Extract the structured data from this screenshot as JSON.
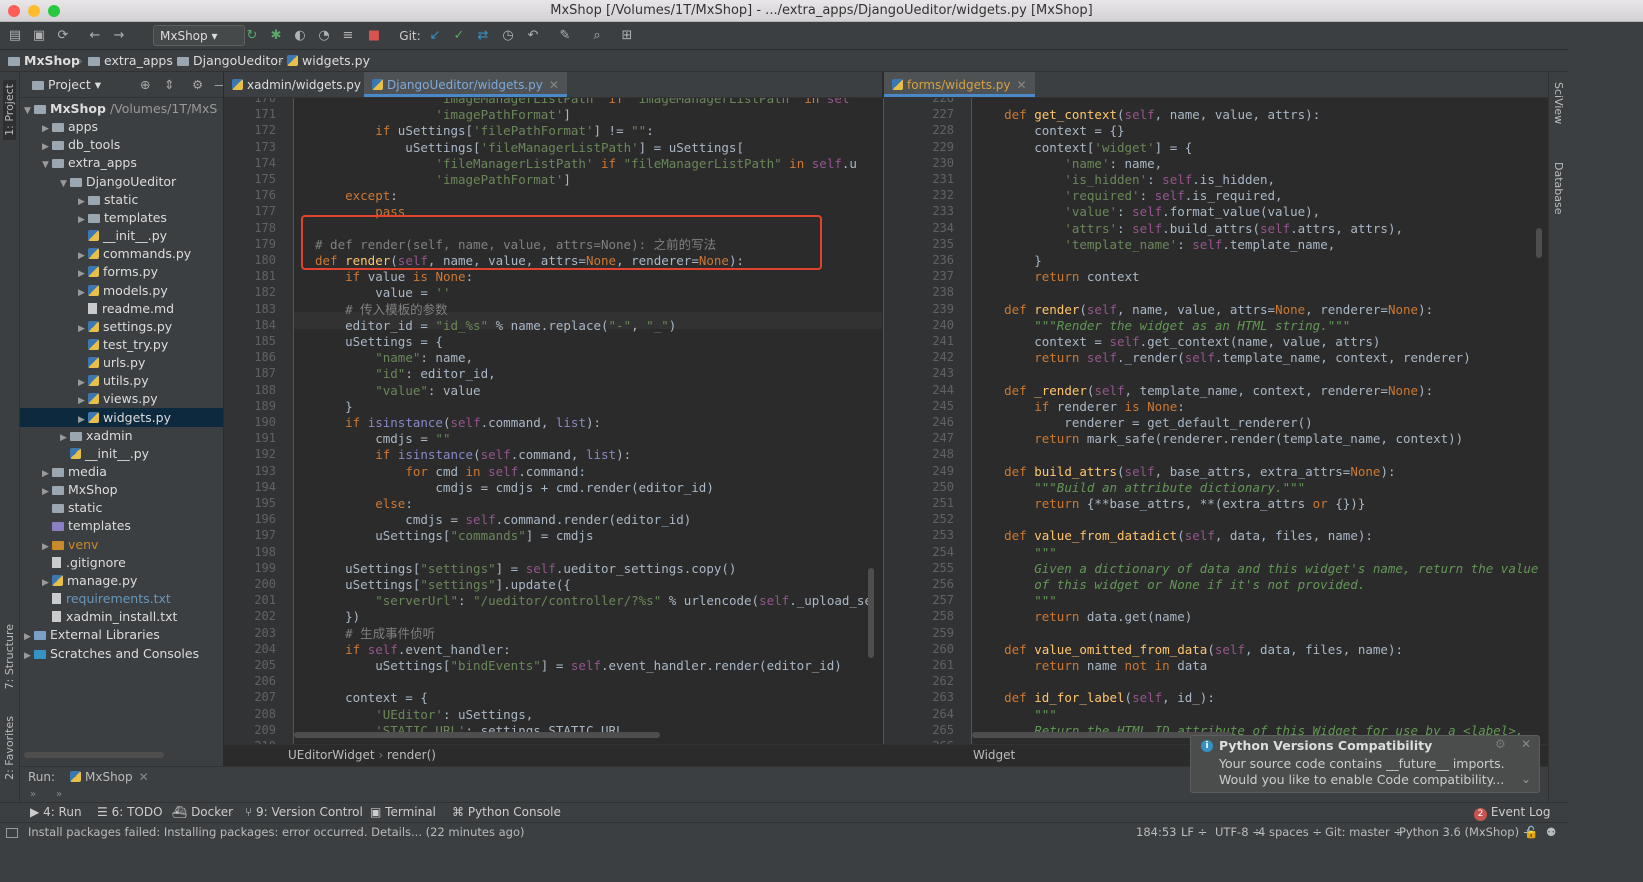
{
  "window": {
    "title": "MxShop [/Volumes/1T/MxShop] - .../extra_apps/DjangoUeditor/widgets.py [MxShop]"
  },
  "toolbar": {
    "run_config": "MxShop",
    "git_label": "Git:"
  },
  "breadcrumb": [
    "MxShop",
    "extra_apps",
    "DjangoUeditor",
    "widgets.py"
  ],
  "left_stripe": {
    "project": "1: Project",
    "structure": "7: Structure",
    "favorites": "2: Favorites"
  },
  "right_stripe": {
    "sciview": "SciView",
    "database": "Database"
  },
  "project": {
    "header": "Project",
    "root_name": "MxShop",
    "root_path": "/Volumes/1T/MxS",
    "items": [
      {
        "label": "apps",
        "depth": 1,
        "kind": "folder",
        "arrow": "right"
      },
      {
        "label": "db_tools",
        "depth": 1,
        "kind": "folder",
        "arrow": "right"
      },
      {
        "label": "extra_apps",
        "depth": 1,
        "kind": "folder",
        "arrow": "down"
      },
      {
        "label": "DjangoUeditor",
        "depth": 2,
        "kind": "folder",
        "arrow": "down"
      },
      {
        "label": "static",
        "depth": 3,
        "kind": "folder",
        "arrow": "right"
      },
      {
        "label": "templates",
        "depth": 3,
        "kind": "folder",
        "arrow": "right"
      },
      {
        "label": "__init__.py",
        "depth": 3,
        "kind": "py",
        "arrow": ""
      },
      {
        "label": "commands.py",
        "depth": 3,
        "kind": "py",
        "arrow": "right"
      },
      {
        "label": "forms.py",
        "depth": 3,
        "kind": "py",
        "arrow": "right"
      },
      {
        "label": "models.py",
        "depth": 3,
        "kind": "py",
        "arrow": "right"
      },
      {
        "label": "readme.md",
        "depth": 3,
        "kind": "txt",
        "arrow": ""
      },
      {
        "label": "settings.py",
        "depth": 3,
        "kind": "py",
        "arrow": "right"
      },
      {
        "label": "test_try.py",
        "depth": 3,
        "kind": "py",
        "arrow": ""
      },
      {
        "label": "urls.py",
        "depth": 3,
        "kind": "py",
        "arrow": ""
      },
      {
        "label": "utils.py",
        "depth": 3,
        "kind": "py",
        "arrow": "right"
      },
      {
        "label": "views.py",
        "depth": 3,
        "kind": "py",
        "arrow": "right"
      },
      {
        "label": "widgets.py",
        "depth": 3,
        "kind": "py",
        "arrow": "right",
        "selected": true
      },
      {
        "label": "xadmin",
        "depth": 2,
        "kind": "folder",
        "arrow": "right"
      },
      {
        "label": "__init__.py",
        "depth": 2,
        "kind": "py",
        "arrow": ""
      },
      {
        "label": "media",
        "depth": 1,
        "kind": "folder",
        "arrow": "right"
      },
      {
        "label": "MxShop",
        "depth": 1,
        "kind": "folder",
        "arrow": "right"
      },
      {
        "label": "static",
        "depth": 1,
        "kind": "folder",
        "arrow": ""
      },
      {
        "label": "templates",
        "depth": 1,
        "kind": "folderp",
        "arrow": ""
      },
      {
        "label": "venv",
        "depth": 1,
        "kind": "venv",
        "arrow": "right",
        "venv": true
      },
      {
        "label": ".gitignore",
        "depth": 1,
        "kind": "git",
        "arrow": ""
      },
      {
        "label": "manage.py",
        "depth": 1,
        "kind": "py",
        "arrow": "right"
      },
      {
        "label": "requirements.txt",
        "depth": 1,
        "kind": "txt",
        "arrow": "",
        "blue": true
      },
      {
        "label": "xadmin_install.txt",
        "depth": 1,
        "kind": "txt",
        "arrow": ""
      },
      {
        "label": "External Libraries",
        "depth": 0,
        "kind": "lib",
        "arrow": "right"
      },
      {
        "label": "Scratches and Consoles",
        "depth": 0,
        "kind": "scratch",
        "arrow": "right"
      }
    ]
  },
  "left_editor": {
    "tabs": [
      {
        "label": "xadmin/widgets.py",
        "active": false
      },
      {
        "label": "DjangoUeditor/widgets.py",
        "active": true
      }
    ],
    "breadcrumb": [
      "UEditorWidget",
      "render()"
    ],
    "lines": [
      {
        "n": "170",
        "html": "                <span class=\"str\">'imageManagerListPath'</span> <span class=\"kw\">if</span> <span class=\"str\">\"imageManagerListPath\"</span> <span class=\"kw\">in</span> <span class=\"sf\">sel</span>"
      },
      {
        "n": "171",
        "html": "                <span class=\"str\">'imagePathFormat'</span>]"
      },
      {
        "n": "172",
        "html": "        <span class=\"kw\">if</span> uSettings[<span class=\"str\">'filePathFormat'</span>] != <span class=\"str\">\"\"</span>:"
      },
      {
        "n": "173",
        "html": "            uSettings[<span class=\"str\">'fileManagerListPath'</span>] = uSettings["
      },
      {
        "n": "174",
        "html": "                <span class=\"str\">'fileManagerListPath'</span> <span class=\"kw\">if</span> <span class=\"str\">\"fileManagerListPath\"</span> <span class=\"kw\">in</span> <span class=\"sf\">self</span>.u"
      },
      {
        "n": "175",
        "html": "                <span class=\"str\">'imagePathFormat'</span>]"
      },
      {
        "n": "176",
        "html": "    <span class=\"kw\">except</span>:"
      },
      {
        "n": "177",
        "html": "        <span class=\"kw\">pass</span>"
      },
      {
        "n": "178",
        "html": ""
      },
      {
        "n": "179",
        "html": "<span class=\"cm\"># def render(self, name, value, attrs=None): 之前的写法</span>"
      },
      {
        "n": "180",
        "html": "<span class=\"kw\">def</span> <span class=\"fn\">render</span>(<span class=\"sf\">self</span>, name, value, attrs=<span class=\"kw\">None</span>, renderer=<span class=\"kw\">None</span>):"
      },
      {
        "n": "181",
        "html": "    <span class=\"kw\">if</span> value <span class=\"kw\">is</span> <span class=\"kw\">None</span>:"
      },
      {
        "n": "182",
        "html": "        value = <span class=\"str\">''</span>"
      },
      {
        "n": "183",
        "html": "    <span class=\"cm\"># 传入模板的参数</span>"
      },
      {
        "n": "184",
        "html": "    editor_id = <span class=\"str\">\"id_%s\"</span> % name.replace(<span class=\"str\">\"-\"</span>, <span class=\"str\">\"_\"</span>)"
      },
      {
        "n": "185",
        "html": "    uSettings = {"
      },
      {
        "n": "186",
        "html": "        <span class=\"str\">\"name\"</span>: name,"
      },
      {
        "n": "187",
        "html": "        <span class=\"str\">\"id\"</span>: editor_id,"
      },
      {
        "n": "188",
        "html": "        <span class=\"str\">\"value\"</span>: value"
      },
      {
        "n": "189",
        "html": "    }"
      },
      {
        "n": "190",
        "html": "    <span class=\"kw\">if</span> <span class=\"bi\">isinstance</span>(<span class=\"sf\">self</span>.command, <span class=\"bi\">list</span>):"
      },
      {
        "n": "191",
        "html": "        cmdjs = <span class=\"str\">\"\"</span>"
      },
      {
        "n": "192",
        "html": "        <span class=\"kw\">if</span> <span class=\"bi\">isinstance</span>(<span class=\"sf\">self</span>.command, <span class=\"bi\">list</span>):"
      },
      {
        "n": "193",
        "html": "            <span class=\"kw\">for</span> cmd <span class=\"kw\">in</span> <span class=\"sf\">self</span>.command:"
      },
      {
        "n": "194",
        "html": "                cmdjs = cmdjs + cmd.render(editor_id)"
      },
      {
        "n": "195",
        "html": "        <span class=\"kw\">else</span>:"
      },
      {
        "n": "196",
        "html": "            cmdjs = <span class=\"sf\">self</span>.command.render(editor_id)"
      },
      {
        "n": "197",
        "html": "        uSettings[<span class=\"str\">\"commands\"</span>] = cmdjs"
      },
      {
        "n": "198",
        "html": ""
      },
      {
        "n": "199",
        "html": "    uSettings[<span class=\"str\">\"settings\"</span>] = <span class=\"sf\">self</span>.ueditor_settings.copy()"
      },
      {
        "n": "200",
        "html": "    uSettings[<span class=\"str\">\"settings\"</span>].update({"
      },
      {
        "n": "201",
        "html": "        <span class=\"str\">\"serverUrl\"</span>: <span class=\"str\">\"/ueditor/controller/?%s\"</span> % urlencode(<span class=\"sf\">self</span>._upload_se"
      },
      {
        "n": "202",
        "html": "    })"
      },
      {
        "n": "203",
        "html": "    <span class=\"cm\"># 生成事件侦听</span>"
      },
      {
        "n": "204",
        "html": "    <span class=\"kw\">if</span> <span class=\"sf\">self</span>.event_handler:"
      },
      {
        "n": "205",
        "html": "        uSettings[<span class=\"str\">\"bindEvents\"</span>] = <span class=\"sf\">self</span>.event_handler.render(editor_id)"
      },
      {
        "n": "206",
        "html": ""
      },
      {
        "n": "207",
        "html": "    context = {"
      },
      {
        "n": "208",
        "html": "        <span class=\"str\">'UEditor'</span>: uSettings,"
      },
      {
        "n": "209",
        "html": "        <span class=\"str\">'STATIC_URL'</span>: settings.STATIC_URL,"
      },
      {
        "n": "210",
        "html": ""
      }
    ]
  },
  "right_editor": {
    "tabs": [
      {
        "label": "forms/widgets.py",
        "active": true
      }
    ],
    "breadcrumb": [
      "Widget"
    ],
    "lines": [
      {
        "n": "226",
        "html": ""
      },
      {
        "n": "227",
        "html": "    <span class=\"kw\">def</span> <span class=\"fn\">get_context</span>(<span class=\"sf\">self</span>, name, value, attrs):"
      },
      {
        "n": "228",
        "html": "        context = {}"
      },
      {
        "n": "229",
        "html": "        context[<span class=\"str\">'widget'</span>] = {"
      },
      {
        "n": "230",
        "html": "            <span class=\"str\">'name'</span>: name,"
      },
      {
        "n": "231",
        "html": "            <span class=\"str\">'is_hidden'</span>: <span class=\"sf\">self</span>.is_hidden,"
      },
      {
        "n": "232",
        "html": "            <span class=\"str\">'required'</span>: <span class=\"sf\">self</span>.is_required,"
      },
      {
        "n": "233",
        "html": "            <span class=\"str\">'value'</span>: <span class=\"sf\">self</span>.format_value(value),"
      },
      {
        "n": "234",
        "html": "            <span class=\"str\">'attrs'</span>: <span class=\"sf\">self</span>.build_attrs(<span class=\"sf\">self</span>.attrs, attrs),"
      },
      {
        "n": "235",
        "html": "            <span class=\"str\">'template_name'</span>: <span class=\"sf\">self</span>.template_name,"
      },
      {
        "n": "236",
        "html": "        }"
      },
      {
        "n": "237",
        "html": "        <span class=\"kw\">return</span> context"
      },
      {
        "n": "238",
        "html": ""
      },
      {
        "n": "239",
        "html": "    <span class=\"kw\">def</span> <span class=\"fn\">render</span>(<span class=\"sf\">self</span>, name, value, attrs=<span class=\"kw\">None</span>, renderer=<span class=\"kw\">None</span>):"
      },
      {
        "n": "240",
        "html": "        <span class=\"doc\">\"\"\"Render the widget as an HTML string.\"\"\"</span>"
      },
      {
        "n": "241",
        "html": "        context = <span class=\"sf\">self</span>.get_context(name, value, attrs)"
      },
      {
        "n": "242",
        "html": "        <span class=\"kw\">return</span> <span class=\"sf\">self</span>._render(<span class=\"sf\">self</span>.template_name, context, renderer)"
      },
      {
        "n": "243",
        "html": ""
      },
      {
        "n": "244",
        "html": "    <span class=\"kw\">def</span> <span class=\"fn\">_render</span>(<span class=\"sf\">self</span>, template_name, context, renderer=<span class=\"kw\">None</span>):"
      },
      {
        "n": "245",
        "html": "        <span class=\"kw\">if</span> renderer <span class=\"kw\">is</span> <span class=\"kw\">None</span>:"
      },
      {
        "n": "246",
        "html": "            renderer = get_default_renderer()"
      },
      {
        "n": "247",
        "html": "        <span class=\"kw\">return</span> mark_safe(renderer.render(template_name, context))"
      },
      {
        "n": "248",
        "html": ""
      },
      {
        "n": "249",
        "html": "    <span class=\"kw\">def</span> <span class=\"fn\">build_attrs</span>(<span class=\"sf\">self</span>, base_attrs, extra_attrs=<span class=\"kw\">None</span>):"
      },
      {
        "n": "250",
        "html": "        <span class=\"doc\">\"\"\"Build an attribute dictionary.\"\"\"</span>"
      },
      {
        "n": "251",
        "html": "        <span class=\"kw\">return</span> {**base_attrs, **(extra_attrs <span class=\"kw\">or</span> {})}"
      },
      {
        "n": "252",
        "html": ""
      },
      {
        "n": "253",
        "html": "    <span class=\"kw\">def</span> <span class=\"fn\">value_from_datadict</span>(<span class=\"sf\">self</span>, data, files, name):"
      },
      {
        "n": "254",
        "html": "        <span class=\"doc\">\"\"\"</span>"
      },
      {
        "n": "255",
        "html": "<span class=\"doc\">        Given a dictionary of data and this widget's name, return the value</span>"
      },
      {
        "n": "256",
        "html": "<span class=\"doc\">        of this widget or None if it's not provided.</span>"
      },
      {
        "n": "257",
        "html": "        <span class=\"doc\">\"\"\"</span>"
      },
      {
        "n": "258",
        "html": "        <span class=\"kw\">return</span> data.get(name)"
      },
      {
        "n": "259",
        "html": ""
      },
      {
        "n": "260",
        "html": "    <span class=\"kw\">def</span> <span class=\"fn\">value_omitted_from_data</span>(<span class=\"sf\">self</span>, data, files, name):"
      },
      {
        "n": "261",
        "html": "        <span class=\"kw\">return</span> name <span class=\"kw\">not in</span> data"
      },
      {
        "n": "262",
        "html": ""
      },
      {
        "n": "263",
        "html": "    <span class=\"kw\">def</span> <span class=\"fn\">id_for_label</span>(<span class=\"sf\">self</span>, id_):"
      },
      {
        "n": "264",
        "html": "        <span class=\"doc\">\"\"\"</span>"
      },
      {
        "n": "265",
        "html": "<span class=\"doc\">        Return the HTML ID attribute of this Widget for use by a &lt;label&gt;,</span>"
      },
      {
        "n": "266",
        "html": ""
      }
    ]
  },
  "run": {
    "label": "Run:",
    "tab": "MxShop"
  },
  "tool_windows": [
    {
      "label": "4: Run",
      "icon": "▶"
    },
    {
      "label": "6: TODO",
      "icon": "☰"
    },
    {
      "label": "Docker",
      "icon": "⛴"
    },
    {
      "label": "9: Version Control",
      "icon": "⑂"
    },
    {
      "label": "Terminal",
      "icon": "▣"
    },
    {
      "label": "Python Console",
      "icon": "⌘"
    }
  ],
  "event_log": {
    "count": "2",
    "label": "Event Log"
  },
  "status": {
    "message": "Install packages failed: Installing packages: error occurred. Details... (22 minutes ago)",
    "position": "184:53",
    "line_sep": "LF ÷",
    "encoding": "UTF-8 ÷",
    "indent": "4 spaces ÷",
    "git": "Git: master ÷",
    "interpreter": "Python 3.6 (MxShop) ÷"
  },
  "notification": {
    "title": "Python Versions Compatibility",
    "line1": "Your source code contains __future__ imports.",
    "line2": "Would you like to enable Code compatibility..."
  }
}
